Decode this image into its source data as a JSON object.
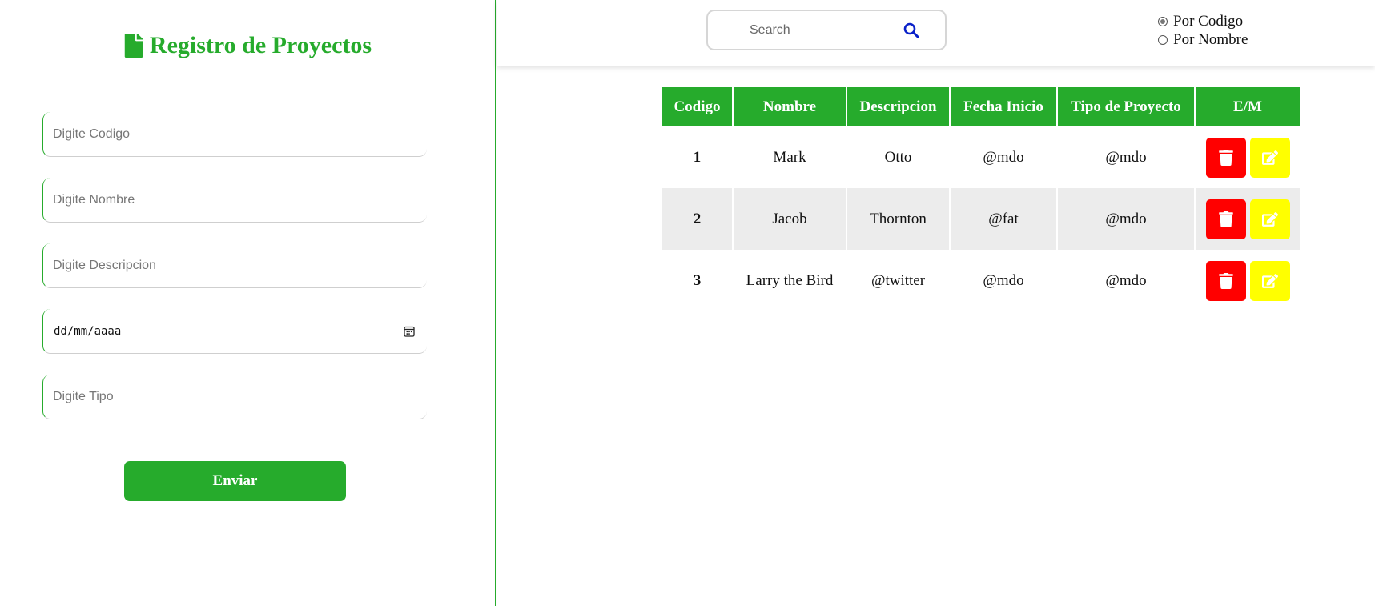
{
  "form": {
    "title": "Registro de Proyectos",
    "title_icon": "file-icon",
    "fields": {
      "codigo_placeholder": "Digite Codigo",
      "nombre_placeholder": "Digite Nombre",
      "descripcion_placeholder": "Digite Descripcion",
      "fecha_text": "dd/mm/aaaa",
      "tipo_placeholder": "Digite Tipo"
    },
    "submit_label": "Enviar"
  },
  "search": {
    "placeholder": "Search",
    "icon": "search-icon"
  },
  "filter": {
    "options": [
      "Por Codigo",
      "Por Nombre"
    ],
    "selected": "Por Codigo"
  },
  "table": {
    "headers": [
      "Codigo",
      "Nombre",
      "Descripcion",
      "Fecha Inicio",
      "Tipo de Proyecto",
      "E/M"
    ],
    "rows": [
      {
        "codigo": "1",
        "nombre": "Mark",
        "descripcion": "Otto",
        "fecha": "@mdo",
        "tipo": "@mdo"
      },
      {
        "codigo": "2",
        "nombre": "Jacob",
        "descripcion": "Thornton",
        "fecha": "@fat",
        "tipo": "@mdo"
      },
      {
        "codigo": "3",
        "nombre": "Larry the Bird",
        "descripcion": "@twitter",
        "fecha": "@mdo",
        "tipo": "@mdo"
      }
    ]
  },
  "colors": {
    "accent": "#26ab2c",
    "delete": "#ff0000",
    "edit": "#ffff00",
    "search_icon": "#0a21c9"
  }
}
